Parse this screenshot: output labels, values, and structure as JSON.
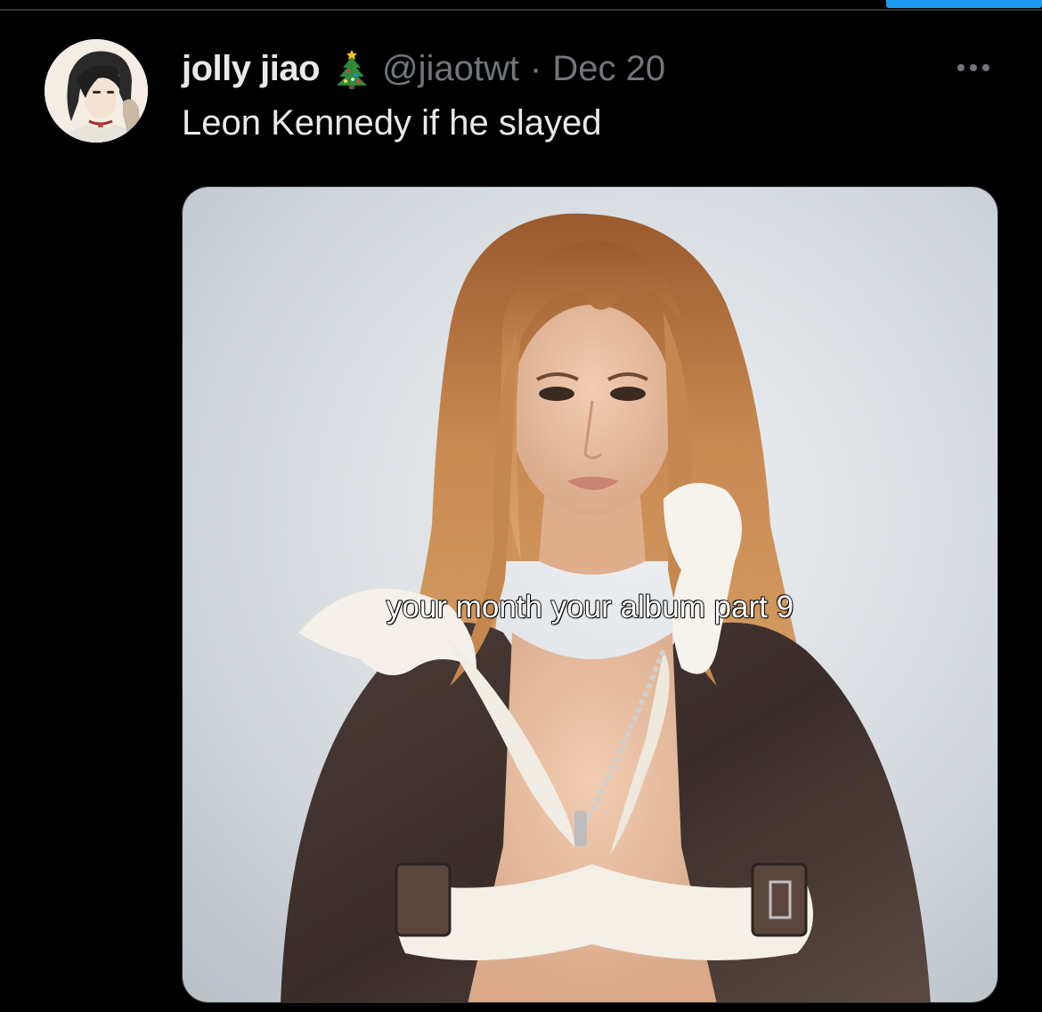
{
  "tweet": {
    "display_name": "jolly jiao",
    "name_emoji": "christmas-tree-icon",
    "handle": "@jiaotwt",
    "separator": "·",
    "date": "Dec 20",
    "text": "Leon Kennedy if he slayed",
    "more_icon": "more-horizontal-icon"
  },
  "media": {
    "overlay_caption": "your month your album part 9"
  },
  "colors": {
    "background": "#000000",
    "primary_text": "#e7e9ea",
    "secondary_text": "#71767b",
    "accent": "#1d9bf0",
    "divider": "#2f3336"
  }
}
